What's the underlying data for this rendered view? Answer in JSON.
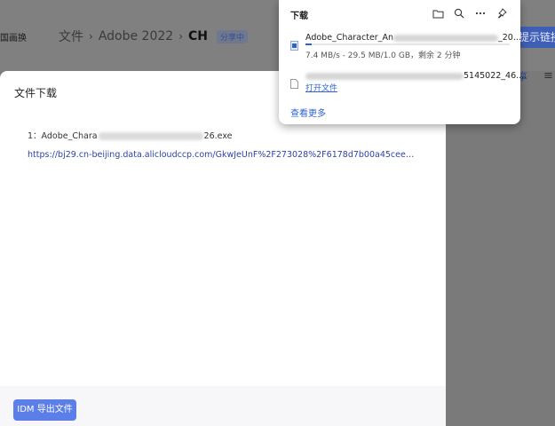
{
  "background": {
    "left_text": "国画换",
    "breadcrumb": {
      "root": "文件",
      "parent": "Adobe 2022",
      "current": "CH",
      "separator": "›",
      "badge": "分享中"
    },
    "right_button": "提示链接",
    "right_link": "享"
  },
  "dialog": {
    "title": "文件下载",
    "file_prefix": "1：Adobe_Chara",
    "file_suffix": "26.exe",
    "url": "https://bj29.cn-beijing.data.alicloudccp.com/GkwJeUnF%2F273028%2F6178d7b00a45cee19d...",
    "export_button": "IDM 导出文件"
  },
  "downloads": {
    "title": "下载",
    "items": [
      {
        "name_prefix": "Adobe_Character_An",
        "name_suffix": "_20...",
        "status": "7.4 MB/s - 29.5 MB/1.0 GB，剩余 2 分钟",
        "progress": 0.03
      },
      {
        "name_suffix": "5145022_46....",
        "action": "打开文件"
      }
    ],
    "more_link": "查看更多"
  },
  "colors": {
    "accent": "#2f63c9",
    "button": "#5b7ee8",
    "url": "#2d43a6"
  }
}
